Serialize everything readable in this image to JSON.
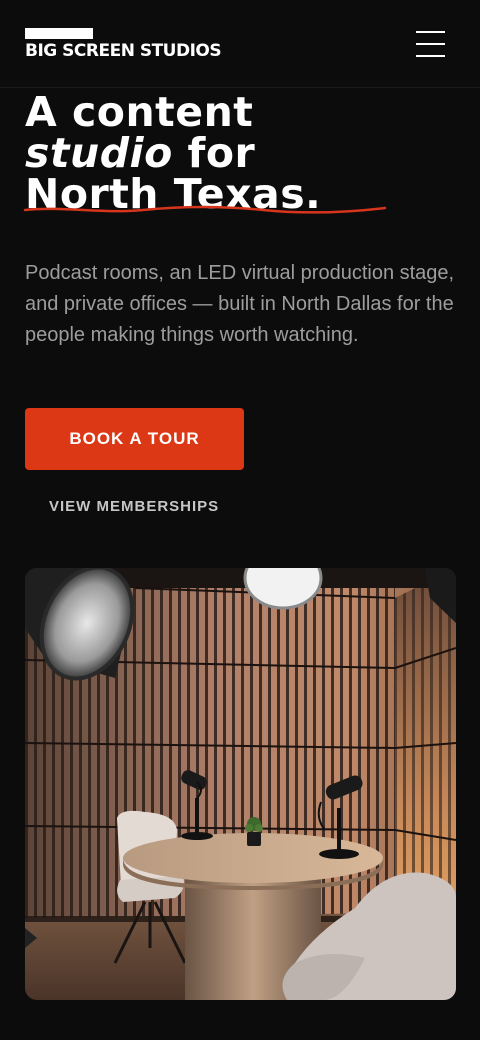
{
  "header": {
    "logo_text": "BIG SCREEN STUDIOS",
    "menu_icon": "hamburger-menu-icon"
  },
  "hero": {
    "title_word_1": "A content",
    "title_word_2_italic": "studio",
    "title_word_3": " for",
    "title_word_4": "North Texas.",
    "underline_color": "#d7351c",
    "subtitle": "Podcast rooms, an LED virtual production stage, and private offices — built in North Dallas for the people making things worth watching."
  },
  "actions": {
    "primary_label": "BOOK A TOUR",
    "secondary_label": "VIEW MEMBERSHIPS"
  },
  "colors": {
    "background": "#0c0c0c",
    "accent": "#dd3815",
    "body_text": "#9d9d9d"
  }
}
